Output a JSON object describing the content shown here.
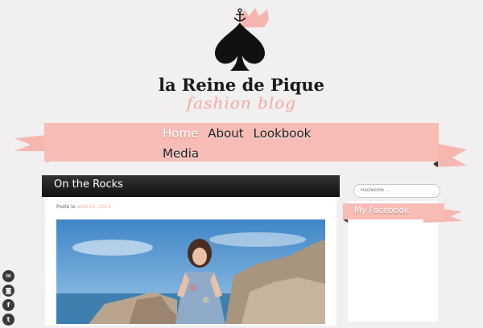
{
  "brand": {
    "title": "la Reine de Pique",
    "subtitle": "fashion blog",
    "accent_color": "#f5b5ae",
    "logo_icon": "spade-crown-icon"
  },
  "nav": {
    "items": [
      {
        "label": "Home",
        "active": true
      },
      {
        "label": "About"
      },
      {
        "label": "Lookbook"
      },
      {
        "label": "Media"
      }
    ]
  },
  "post": {
    "title": "On the Rocks",
    "meta_prefix": "Posté le",
    "date": "août 25, 2014",
    "image_icon": "beach-rocks-photo"
  },
  "sidebar": {
    "search_placeholder": "Recherche ...",
    "widget_title": "My Facebook"
  },
  "social": {
    "icons": [
      "email-icon",
      "instagram-icon",
      "facebook-icon",
      "twitter-icon"
    ]
  }
}
